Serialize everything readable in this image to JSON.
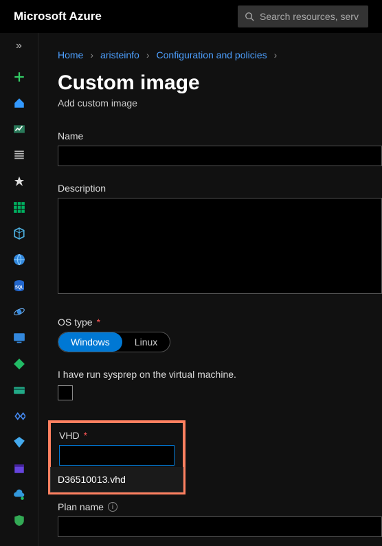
{
  "topbar": {
    "logo": "Microsoft Azure",
    "search_placeholder": "Search resources, serv"
  },
  "breadcrumb": {
    "items": [
      "Home",
      "aristeinfo",
      "Configuration and policies"
    ]
  },
  "page": {
    "title": "Custom image",
    "subtitle": "Add custom image"
  },
  "form": {
    "name_label": "Name",
    "name_value": "",
    "description_label": "Description",
    "description_value": "",
    "os_type_label": "OS type",
    "os_windows": "Windows",
    "os_linux": "Linux",
    "sysprep_label": "I have run sysprep on the virtual machine.",
    "vhd_label": "VHD",
    "vhd_value": "",
    "vhd_option": "D36510013.vhd",
    "plan_name_label": "Plan name",
    "plan_name_value": ""
  }
}
